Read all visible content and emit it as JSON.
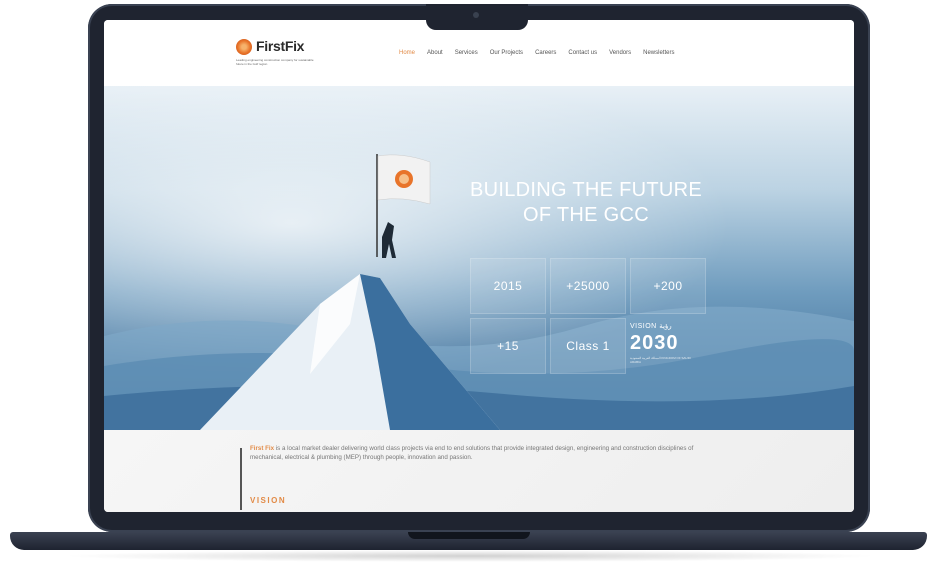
{
  "site": {
    "logo_text": "FirstFix",
    "logo_tagline": "Leading engineering construction company for sustainable future in the Gulf region"
  },
  "nav": {
    "items": [
      "Home",
      "About",
      "Services",
      "Our Projects",
      "Careers",
      "Contact us",
      "Vendors",
      "Newsletters"
    ],
    "active": "Home"
  },
  "hero": {
    "headline_line1": "BUILDING THE FUTURE",
    "headline_line2": "OF THE GCC",
    "stats": [
      {
        "value": "2015"
      },
      {
        "value": "+25000"
      },
      {
        "value": "+200"
      },
      {
        "value": "+15"
      },
      {
        "value": "Class 1"
      }
    ],
    "vision_logo": {
      "top": "VISION رؤية",
      "year": "2030",
      "sub": "المملكة العربية السعودية KINGDOM OF SAUDI ARABIA"
    }
  },
  "about": {
    "brand": "First Fix",
    "text": " is a local market dealer delivering world class projects via end to end solutions that provide integrated design, engineering and construction disciplines of mechanical, electrical & plumbing (MEP) through people, innovation and passion.",
    "vision_heading": "VISION"
  },
  "colors": {
    "accent": "#e28b47",
    "frame": "#1f2430",
    "hero_deep": "#2f5f8c"
  }
}
